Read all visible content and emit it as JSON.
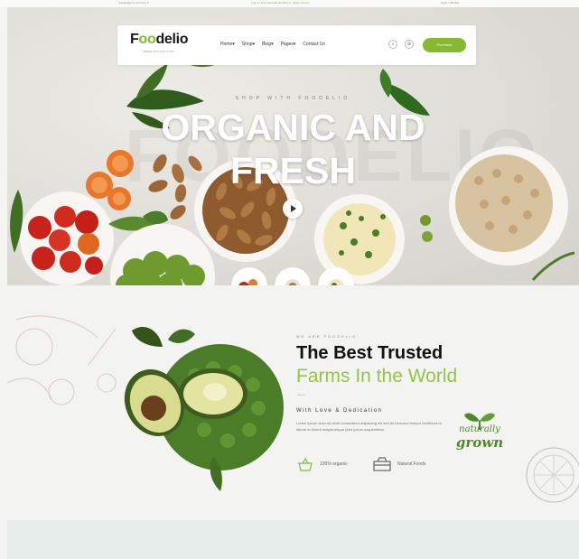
{
  "topbar": {
    "left": "Language ▾  |  Currency ▾",
    "middle": "Free on first international delivery • Easy returns",
    "right": "Login / Wishlist"
  },
  "nav": {
    "logo_part1": "F",
    "logo_o": "oo",
    "logo_part2": "delio",
    "logo_tag": "FRESH ORGANIC FOOD",
    "menu": [
      "Home",
      "Shop",
      "Blog",
      "Pages",
      "Contact Us"
    ],
    "purchase_label": "Purchase"
  },
  "hero": {
    "subtitle": "SHOP WITH FOODELIO",
    "title_line1": "ORGANIC AND",
    "title_line2": "FRESH",
    "watermark": "FOODELIO"
  },
  "about": {
    "subtitle": "WE ARE FOODELIO",
    "title_line1": "The Best Trusted",
    "title_line2": "Farms In the World",
    "tiny": "About",
    "dedication": "With Love & Dedication",
    "paragraph": "Lorem ipsum dolor sit amet consectetur adipiscing elit sed do eiusmod tempor incididunt ut labore et dolore magna aliqua Quis ipsum suspendisse",
    "feature1": "100% organic",
    "feature2": "Natural Foods",
    "badge_line1": "naturally",
    "badge_line2": "grown"
  },
  "colors": {
    "accent": "#86b832",
    "title_green": "#9ac24a",
    "badge_green": "#4c8a28"
  }
}
